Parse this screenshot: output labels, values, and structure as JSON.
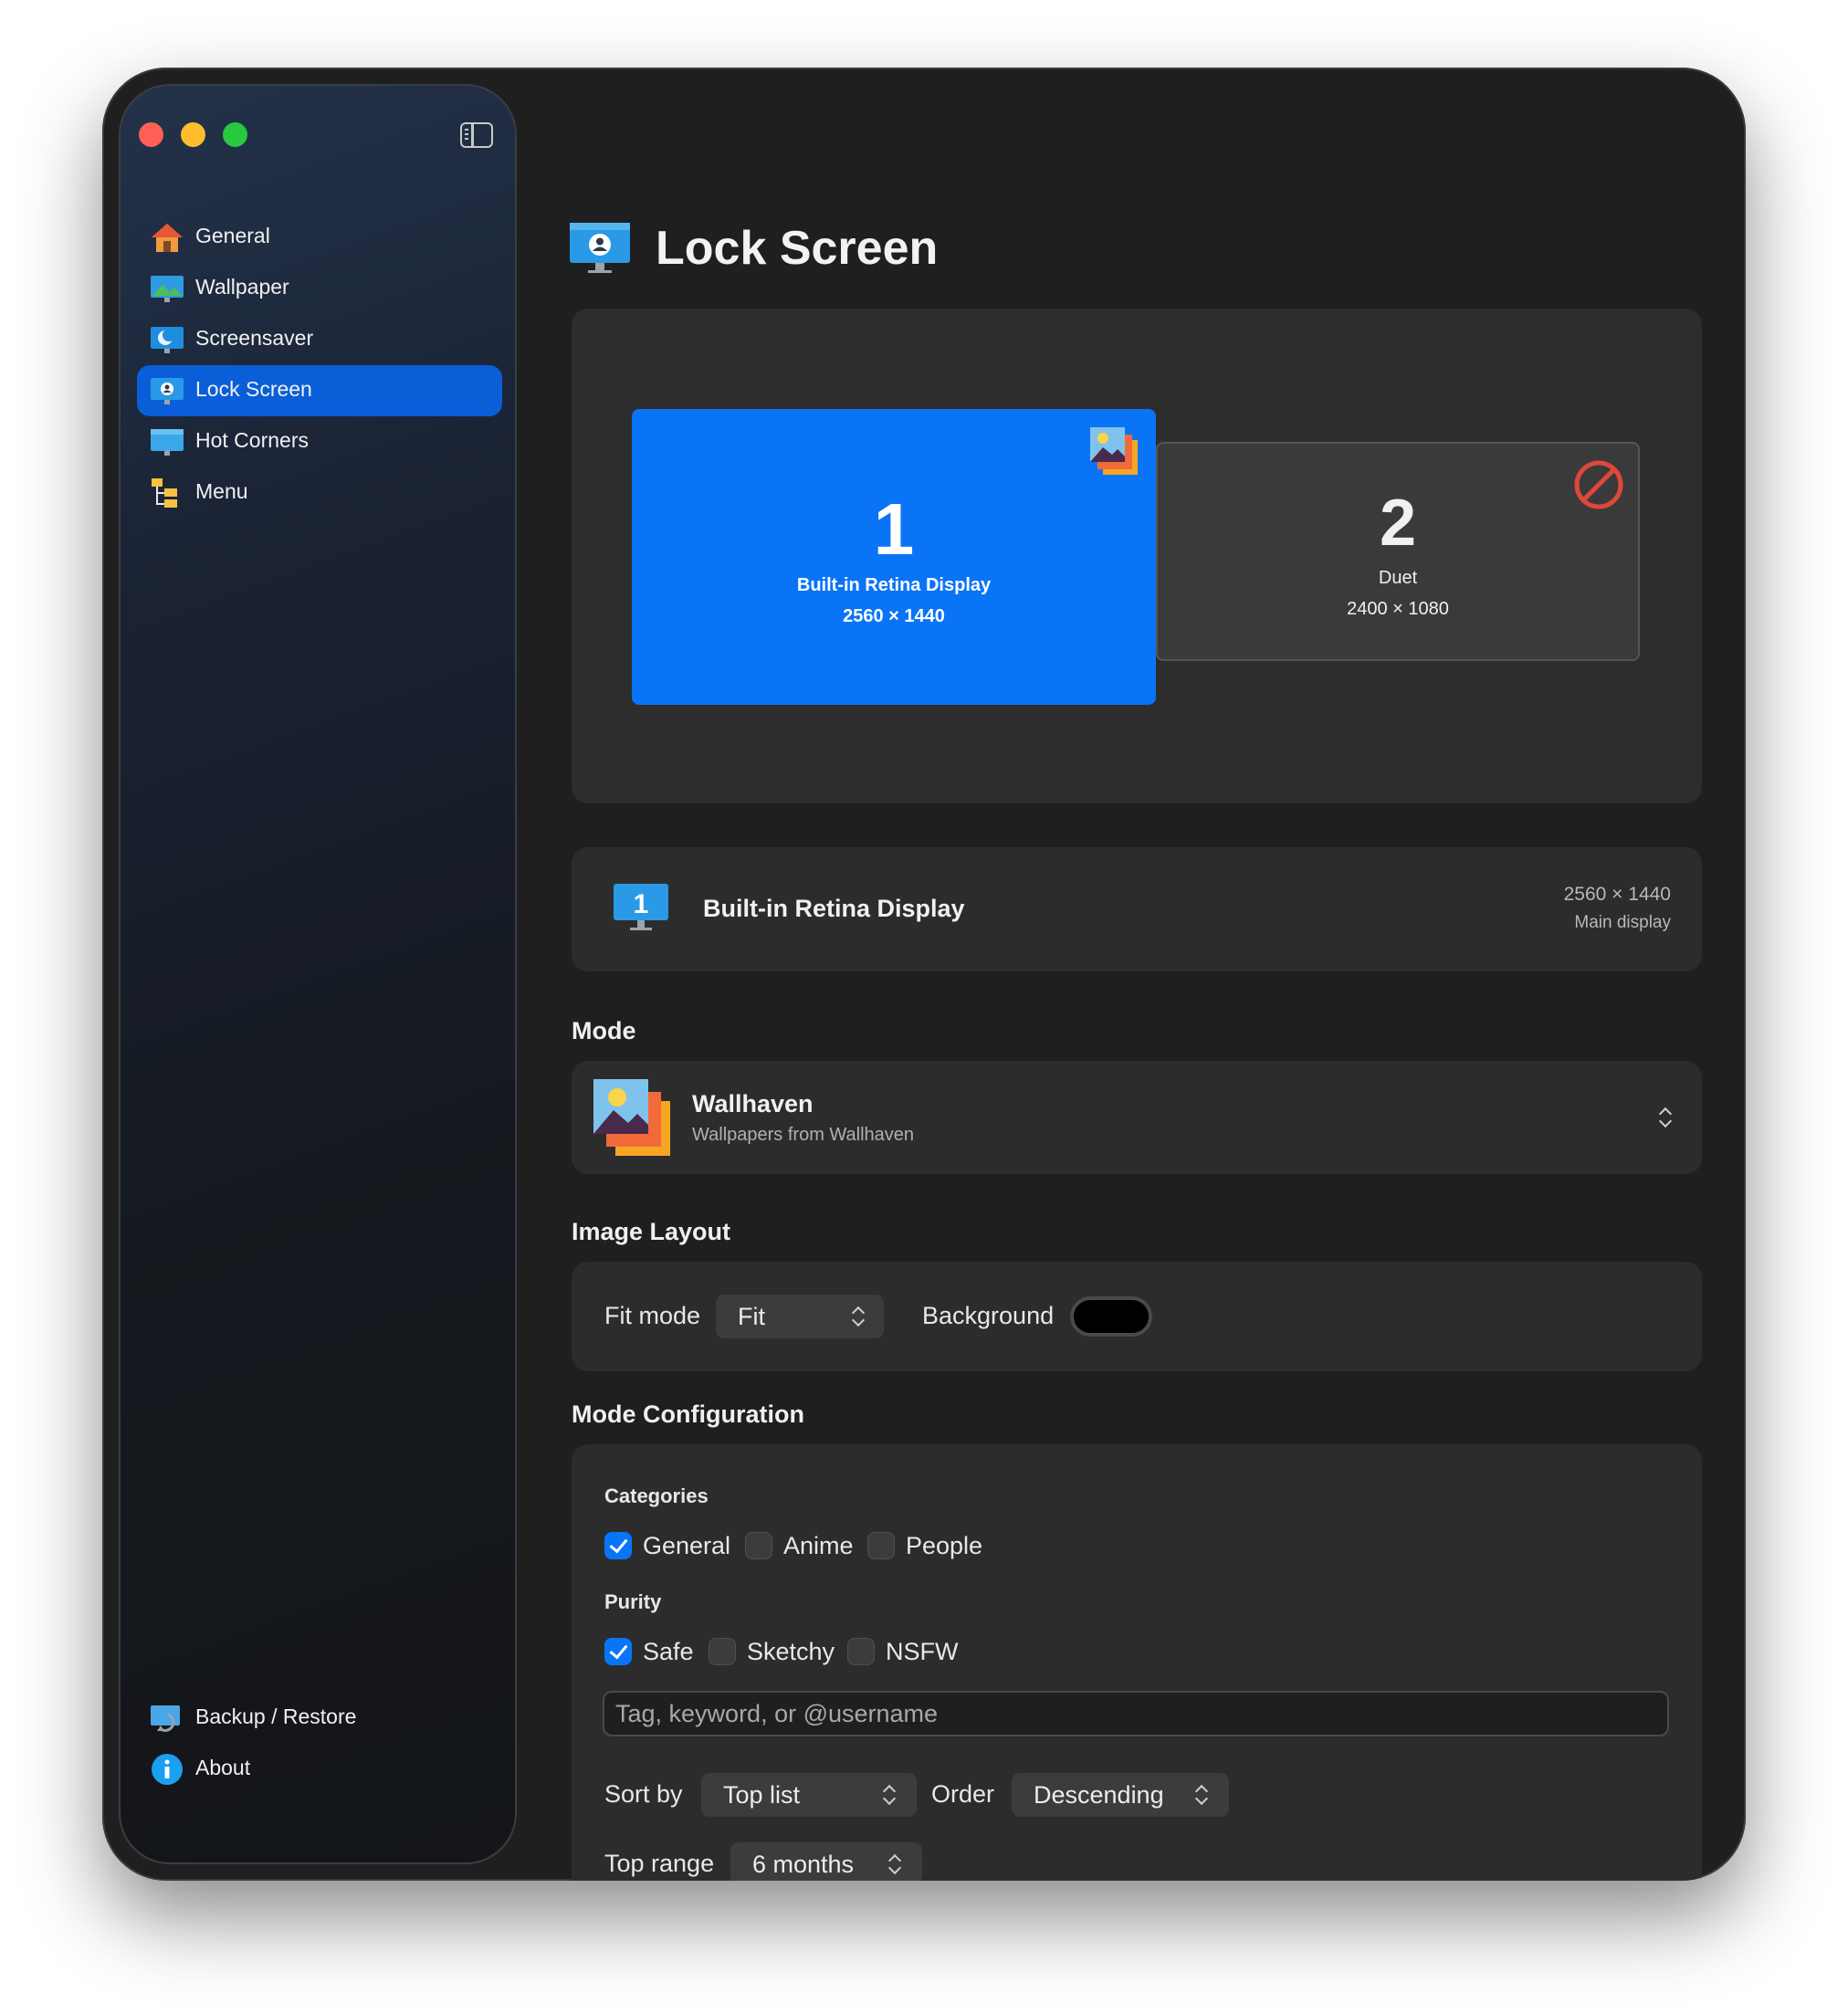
{
  "sidebar": {
    "items": [
      {
        "label": "General",
        "icon": "house-icon",
        "active": false
      },
      {
        "label": "Wallpaper",
        "icon": "wallpaper-icon",
        "active": false
      },
      {
        "label": "Screensaver",
        "icon": "screensaver-moon-icon",
        "active": false
      },
      {
        "label": "Lock Screen",
        "icon": "lock-screen-user-icon",
        "active": true
      },
      {
        "label": "Hot Corners",
        "icon": "hot-corners-monitor-icon",
        "active": false
      },
      {
        "label": "Menu",
        "icon": "menu-tree-icon",
        "active": false
      }
    ],
    "footer": [
      {
        "label": "Backup / Restore",
        "icon": "backup-restore-icon"
      },
      {
        "label": "About",
        "icon": "info-icon"
      }
    ]
  },
  "main": {
    "title": "Lock Screen",
    "displays": [
      {
        "number": "1",
        "name": "Built-in Retina Display",
        "resolution": "2560 × 1440",
        "selected": true
      },
      {
        "number": "2",
        "name": "Duet",
        "resolution": "2400 × 1080",
        "selected": false
      }
    ],
    "display_info": {
      "number": "1",
      "name": "Built-in Retina Display",
      "resolution": "2560 × 1440",
      "subtitle": "Main display"
    },
    "mode": {
      "heading": "Mode",
      "title": "Wallhaven",
      "subtitle": "Wallpapers from Wallhaven"
    },
    "image_layout": {
      "heading": "Image Layout",
      "fit_mode_label": "Fit mode",
      "fit_mode_value": "Fit",
      "background_label": "Background",
      "background_color": "#000000"
    },
    "config": {
      "heading": "Mode Configuration",
      "categories_label": "Categories",
      "categories": [
        {
          "label": "General",
          "checked": true
        },
        {
          "label": "Anime",
          "checked": false
        },
        {
          "label": "People",
          "checked": false
        }
      ],
      "purity_label": "Purity",
      "purity": [
        {
          "label": "Safe",
          "checked": true
        },
        {
          "label": "Sketchy",
          "checked": false
        },
        {
          "label": "NSFW",
          "checked": false
        }
      ],
      "search_placeholder": "Tag, keyword, or @username",
      "sort_by_label": "Sort by",
      "sort_by_value": "Top list",
      "order_label": "Order",
      "order_value": "Descending",
      "top_range_label": "Top range",
      "top_range_value": "6 months"
    }
  },
  "colors": {
    "accent": "#0a74f7",
    "sidebar_active": "#0a5fd8",
    "window_bg": "#1f1f1f",
    "card_bg": "#2c2c2c"
  }
}
